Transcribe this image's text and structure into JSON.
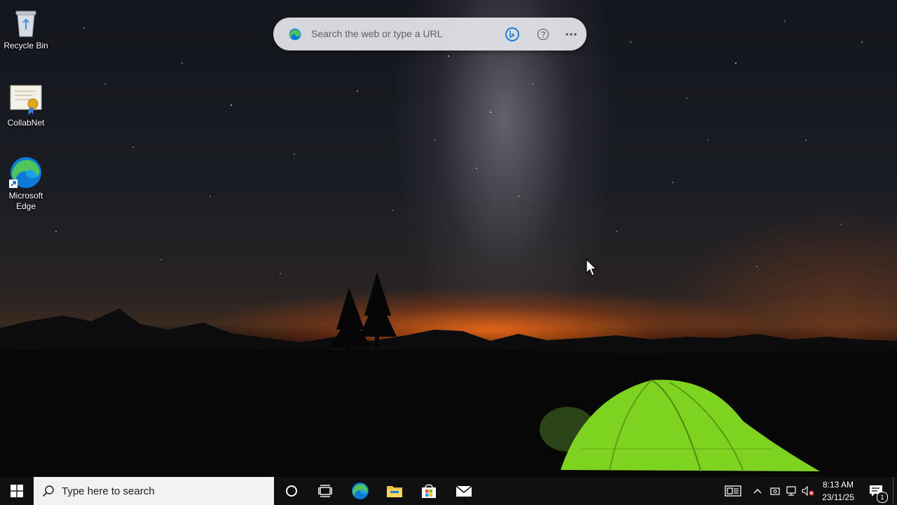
{
  "desktop": {
    "icons": [
      {
        "label": "Recycle Bin"
      },
      {
        "label": "CollabNet"
      },
      {
        "label": "Microsoft Edge"
      }
    ]
  },
  "edge_search_bar": {
    "placeholder": "Search the web or type a URL"
  },
  "taskbar": {
    "search_placeholder": "Type here to search",
    "clock_time": "8:13 AM",
    "clock_date": "23/11/25",
    "notification_count": "1"
  },
  "colors": {
    "taskbar": "#101010",
    "edge_blue": "#0c7bd8",
    "edge_green": "#4fc45c",
    "tent_green": "#7ed321"
  }
}
